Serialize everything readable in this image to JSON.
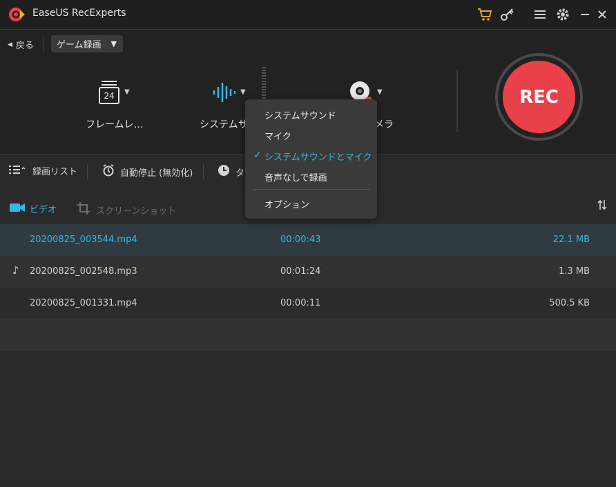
{
  "app": {
    "title": "EaseUS RecExperts"
  },
  "nav": {
    "back_label": "戻る",
    "mode_value": "ゲーム録画"
  },
  "tools": {
    "frame_rate": {
      "value": "24",
      "label": "フレームレ…"
    },
    "audio": {
      "label": "システムサ"
    },
    "webcam": {
      "label": "メラ"
    },
    "rec_label": "REC"
  },
  "toolbar2": {
    "record_list": "録画リスト",
    "auto_stop": "自動停止 (無効化)",
    "schedule_partial": "タ"
  },
  "tabs": {
    "video": "ビデオ",
    "screenshot": "スクリーンショット"
  },
  "recordings": [
    {
      "name": "20200825_003544.mp4",
      "duration": "00:00:43",
      "size": "22.1 MB",
      "type": "video",
      "selected": true
    },
    {
      "name": "20200825_002548.mp3",
      "duration": "00:01:24",
      "size": "1.3 MB",
      "type": "audio",
      "selected": false
    },
    {
      "name": "20200825_001331.mp4",
      "duration": "00:00:11",
      "size": "500.5 KB",
      "type": "video",
      "selected": false
    }
  ],
  "audio_menu": {
    "items": [
      "システムサウンド",
      "マイク",
      "システムサウンドとマイク",
      "音声なしで録画"
    ],
    "selected_index": 2,
    "options": "オプション"
  },
  "colors": {
    "accent": "#35b6e6",
    "rec": "#e9404a",
    "selected_row": "#2f3b40"
  }
}
